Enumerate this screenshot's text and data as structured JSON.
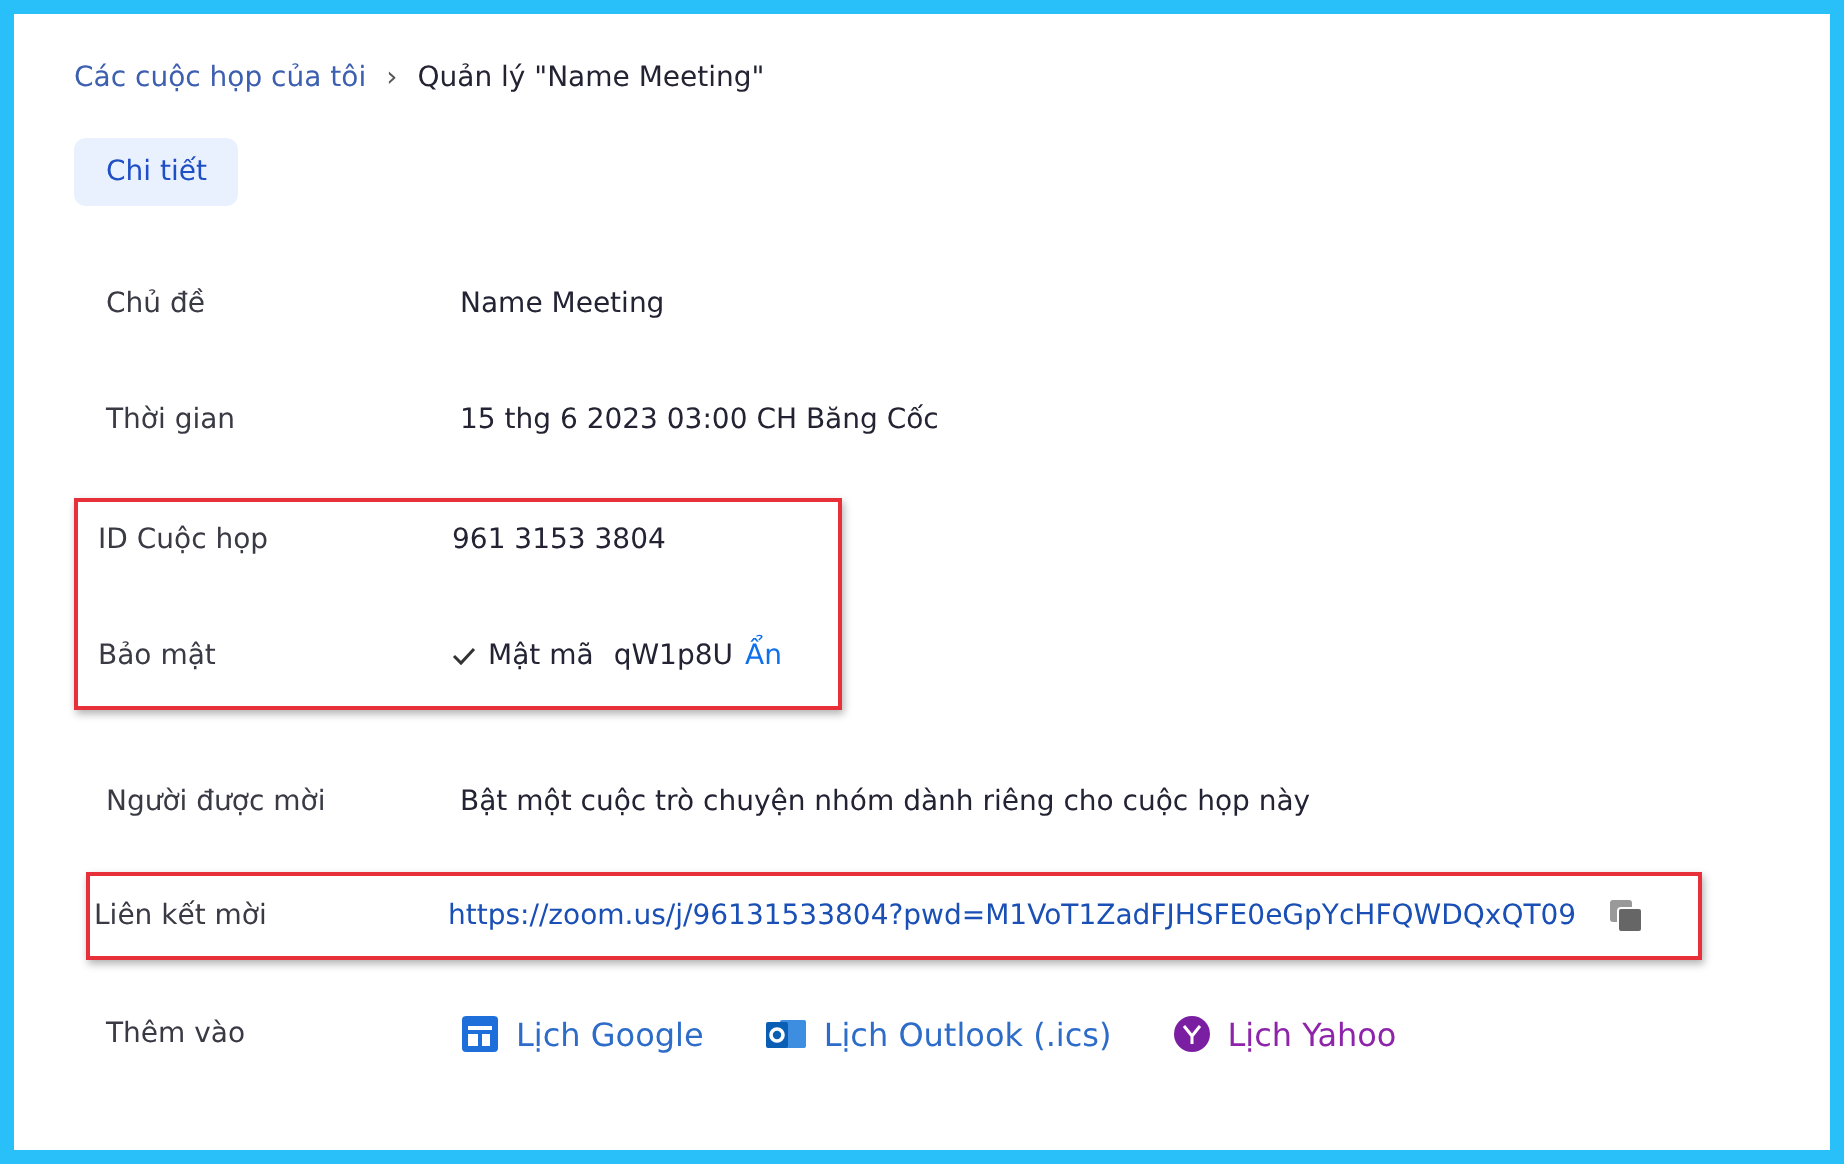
{
  "breadcrumb": {
    "parent": "Các cuộc họp của tôi",
    "separator": "›",
    "current": "Quản lý \"Name Meeting\""
  },
  "tabs": [
    {
      "label": "Chi tiết",
      "selected": true
    }
  ],
  "sections": [
    {
      "highlighted": false,
      "rows": [
        {
          "kind": "text",
          "label": "Chủ đề",
          "value": "Name Meeting"
        },
        {
          "kind": "text",
          "label": "Thời gian",
          "value": "15 thg 6 2023 03:00 CH Băng Cốc"
        }
      ]
    },
    {
      "highlighted": true,
      "rows": [
        {
          "kind": "text",
          "label": "ID Cuộc họp",
          "value": "961 3153 3804"
        },
        {
          "kind": "password",
          "label": "Bảo mật",
          "checked": true,
          "name": "Mật mã",
          "value": "qW1p8U",
          "action": "Ẩn"
        }
      ]
    },
    {
      "highlighted": false,
      "rows": [
        {
          "kind": "text",
          "label": "Người được mời",
          "value": "Bật một cuộc trò chuyện nhóm dành riêng cho cuộc họp này"
        }
      ]
    },
    {
      "highlighted": true,
      "rows": [
        {
          "kind": "link",
          "label": "Liên kết mời",
          "value": "https://zoom.us/j/96131533804?pwd=M1VoT1ZadFJHSFE0eGpYcHFQWDQxQT09"
        }
      ]
    },
    {
      "highlighted": false,
      "rows": [
        {
          "kind": "calendars",
          "label": "Thêm vào",
          "items": [
            {
              "kind": "google",
              "label": "Lịch Google"
            },
            {
              "kind": "outlook",
              "label": "Lịch Outlook (.ics)"
            },
            {
              "kind": "yahoo",
              "label": "Lịch Yahoo"
            }
          ]
        }
      ]
    }
  ]
}
